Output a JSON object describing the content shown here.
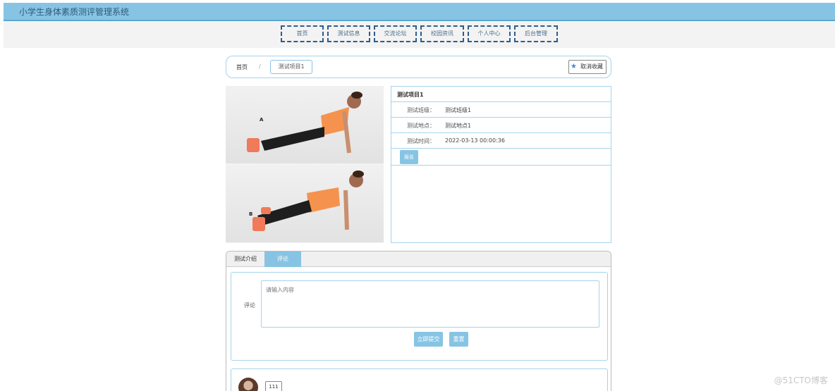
{
  "app": {
    "title": "小学生身体素质测评管理系统"
  },
  "nav": {
    "items": [
      {
        "label": "首页"
      },
      {
        "label": "测试信息"
      },
      {
        "label": "交流论坛"
      },
      {
        "label": "校园资讯"
      },
      {
        "label": "个人中心"
      },
      {
        "label": "后台管理"
      }
    ]
  },
  "breadcrumb": {
    "home": "首页",
    "separator": "/",
    "current": "测试项目1"
  },
  "favorite": {
    "label": "取消收藏",
    "icon": "star-icon"
  },
  "photo": {
    "label_a": "A",
    "label_b": "B"
  },
  "details": {
    "title": "测试项目1",
    "rows": [
      {
        "key": "测试班级：",
        "value": "测试班级1"
      },
      {
        "key": "测试地点：",
        "value": "测试地点1"
      },
      {
        "key": "测试时间：",
        "value": "2022-03-13 00:00:36"
      }
    ],
    "signup_label": "报名"
  },
  "tabs": [
    {
      "label": "测试介绍"
    },
    {
      "label": "评论"
    }
  ],
  "comment_form": {
    "label": "评论",
    "placeholder": "请输入内容",
    "submit_label": "立即提交",
    "reset_label": "重置"
  },
  "comments": [
    {
      "text": "111"
    }
  ],
  "watermark": "@51CTO博客",
  "colors": {
    "accent": "#87c4e4",
    "nav_border": "#2c5d8c"
  }
}
